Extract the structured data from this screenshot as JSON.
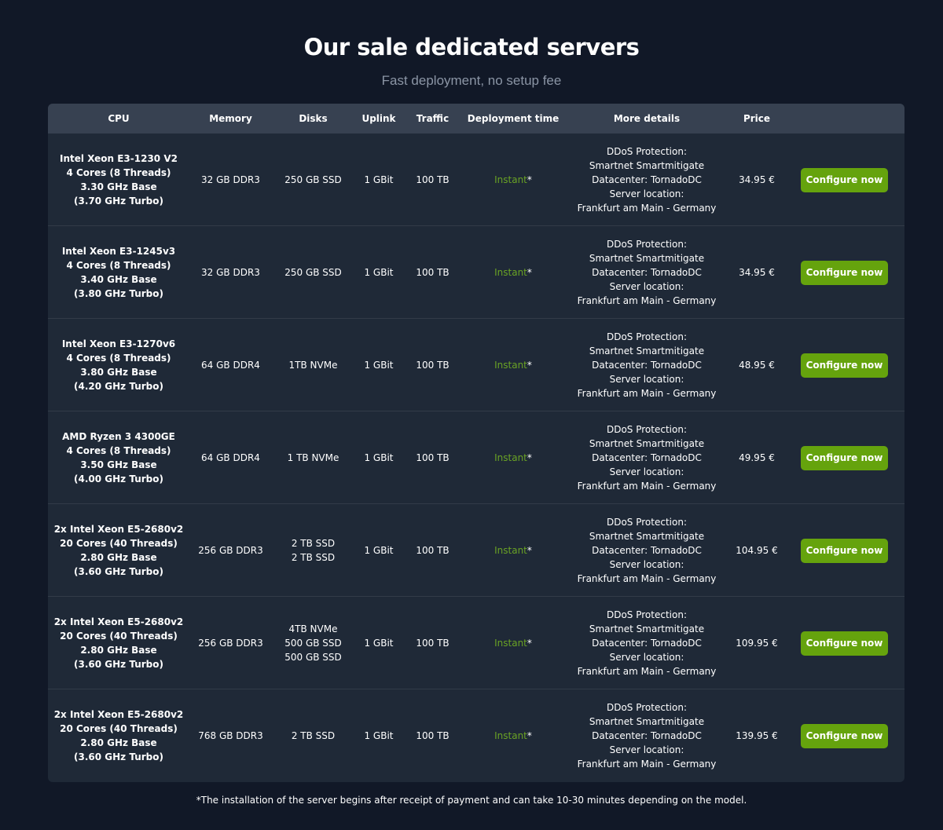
{
  "header": {
    "title": "Our sale dedicated servers",
    "subtitle": "Fast deployment, no setup fee"
  },
  "table": {
    "columns": [
      "CPU",
      "Memory",
      "Disks",
      "Uplink",
      "Traffic",
      "Deployment time",
      "More details",
      "Price",
      ""
    ],
    "rows": [
      {
        "cpu": [
          "Intel Xeon E3-1230 V2",
          "4 Cores (8 Threads)",
          "3.30 GHz Base",
          "(3.70 GHz Turbo)"
        ],
        "memory": "32 GB DDR3",
        "disks": [
          "250 GB SSD"
        ],
        "uplink": "1 GBit",
        "traffic": "100 TB",
        "deployment": "Instant",
        "deployment_star": "*",
        "details": [
          "DDoS Protection:",
          "Smartnet Smartmitigate",
          "Datacenter: TornadoDC",
          "Server location:",
          "Frankfurt am Main - Germany"
        ],
        "price": "34.95 €",
        "button": "Configure now"
      },
      {
        "cpu": [
          "Intel Xeon E3-1245v3",
          "4 Cores (8 Threads)",
          "3.40 GHz Base",
          "(3.80 GHz Turbo)"
        ],
        "memory": "32 GB DDR3",
        "disks": [
          "250 GB SSD"
        ],
        "uplink": "1 GBit",
        "traffic": "100 TB",
        "deployment": "Instant",
        "deployment_star": "*",
        "details": [
          "DDoS Protection:",
          "Smartnet Smartmitigate",
          "Datacenter: TornadoDC",
          "Server location:",
          "Frankfurt am Main - Germany"
        ],
        "price": "34.95 €",
        "button": "Configure now"
      },
      {
        "cpu": [
          "Intel Xeon E3-1270v6",
          "4 Cores (8 Threads)",
          "3.80 GHz Base",
          "(4.20 GHz Turbo)"
        ],
        "memory": "64 GB DDR4",
        "disks": [
          "1TB NVMe"
        ],
        "uplink": "1 GBit",
        "traffic": "100 TB",
        "deployment": "Instant",
        "deployment_star": "*",
        "details": [
          "DDoS Protection:",
          "Smartnet Smartmitigate",
          "Datacenter: TornadoDC",
          "Server location:",
          "Frankfurt am Main - Germany"
        ],
        "price": "48.95 €",
        "button": "Configure now"
      },
      {
        "cpu": [
          "AMD Ryzen 3 4300GE",
          "4 Cores (8 Threads)",
          "3.50 GHz Base",
          "(4.00 GHz Turbo)"
        ],
        "memory": "64 GB DDR4",
        "disks": [
          "1 TB NVMe"
        ],
        "uplink": "1 GBit",
        "traffic": "100 TB",
        "deployment": "Instant",
        "deployment_star": "*",
        "details": [
          "DDoS Protection:",
          "Smartnet Smartmitigate",
          "Datacenter: TornadoDC",
          "Server location:",
          "Frankfurt am Main - Germany"
        ],
        "price": "49.95 €",
        "button": "Configure now"
      },
      {
        "cpu": [
          "2x Intel Xeon E5-2680v2",
          "20 Cores (40 Threads)",
          "2.80 GHz Base",
          "(3.60 GHz Turbo)"
        ],
        "memory": "256 GB DDR3",
        "disks": [
          "2 TB SSD",
          "2 TB SSD"
        ],
        "uplink": "1 GBit",
        "traffic": "100 TB",
        "deployment": "Instant",
        "deployment_star": "*",
        "details": [
          "DDoS Protection:",
          "Smartnet Smartmitigate",
          "Datacenter: TornadoDC",
          "Server location:",
          "Frankfurt am Main - Germany"
        ],
        "price": "104.95 €",
        "button": "Configure now"
      },
      {
        "cpu": [
          "2x Intel Xeon E5-2680v2",
          "20 Cores (40 Threads)",
          "2.80 GHz Base",
          "(3.60 GHz Turbo)"
        ],
        "memory": "256 GB DDR3",
        "disks": [
          "4TB NVMe",
          "500 GB SSD",
          "500 GB SSD"
        ],
        "uplink": "1 GBit",
        "traffic": "100 TB",
        "deployment": "Instant",
        "deployment_star": "*",
        "details": [
          "DDoS Protection:",
          "Smartnet Smartmitigate",
          "Datacenter: TornadoDC",
          "Server location:",
          "Frankfurt am Main - Germany"
        ],
        "price": "109.95 €",
        "button": "Configure now"
      },
      {
        "cpu": [
          "2x Intel Xeon E5-2680v2",
          "20 Cores (40 Threads)",
          "2.80 GHz Base",
          "(3.60 GHz Turbo)"
        ],
        "memory": "768 GB DDR3",
        "disks": [
          "2 TB SSD"
        ],
        "uplink": "1 GBit",
        "traffic": "100 TB",
        "deployment": "Instant",
        "deployment_star": "*",
        "details": [
          "DDoS Protection:",
          "Smartnet Smartmitigate",
          "Datacenter: TornadoDC",
          "Server location:",
          "Frankfurt am Main - Germany"
        ],
        "price": "139.95 €",
        "button": "Configure now"
      }
    ]
  },
  "footnote": "*The installation of the server begins after receipt of payment and can take 10-30 minutes depending on the model.",
  "colors": {
    "background": "#111827",
    "table_body": "#1f2937",
    "table_header": "#374151",
    "button": "#65a30d",
    "instant_text": "#6aa324",
    "subtitle_text": "#8b95a5"
  }
}
